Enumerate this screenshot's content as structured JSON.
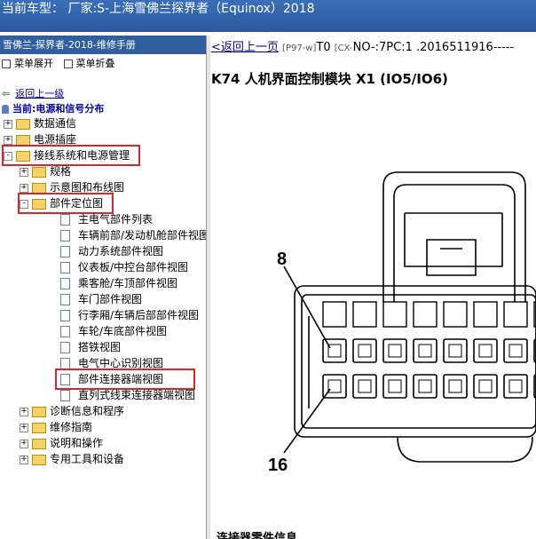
{
  "window": {
    "title": "当前车型： 厂家:S-上海雪佛兰探界者（Equinox）2018"
  },
  "left_panel": {
    "header": "雪佛兰-探界者-2018-维修手册",
    "toolbar": {
      "expand": "菜单展开",
      "collapse": "菜单折叠"
    },
    "back_link": "返回上一级",
    "current": "当前:电源和信号分布",
    "tree": [
      {
        "label": "数据通信",
        "level": 0,
        "type": "folder",
        "expander": "+"
      },
      {
        "label": "电源插座",
        "level": 0,
        "type": "folder",
        "expander": "+"
      },
      {
        "label": "接线系统和电源管理",
        "level": 0,
        "type": "folder",
        "expander": "-",
        "highlight": true
      },
      {
        "label": "规格",
        "level": 1,
        "type": "folder",
        "expander": "+"
      },
      {
        "label": "示意图和布线图",
        "level": 1,
        "type": "folder",
        "expander": "+"
      },
      {
        "label": "部件定位图",
        "level": 1,
        "type": "folder",
        "expander": "-",
        "highlight": true
      },
      {
        "label": "主电气部件列表",
        "level": 2,
        "type": "doc"
      },
      {
        "label": "车辆前部/发动机舱部件视图",
        "level": 2,
        "type": "doc"
      },
      {
        "label": "动力系统部件视图",
        "level": 2,
        "type": "doc"
      },
      {
        "label": "仪表板/中控台部件视图",
        "level": 2,
        "type": "doc"
      },
      {
        "label": "乘客舱/车顶部件视图",
        "level": 2,
        "type": "doc"
      },
      {
        "label": "车门部件视图",
        "level": 2,
        "type": "doc"
      },
      {
        "label": "行李厢/车辆后部部件视图",
        "level": 2,
        "type": "doc"
      },
      {
        "label": "车轮/车底部件视图",
        "level": 2,
        "type": "doc"
      },
      {
        "label": "搭铁视图",
        "level": 2,
        "type": "doc"
      },
      {
        "label": "电气中心识别视图",
        "level": 2,
        "type": "doc"
      },
      {
        "label": "部件连接器端视图",
        "level": 2,
        "type": "doc",
        "highlight": true
      },
      {
        "label": "直列式线束连接器端视图",
        "level": 2,
        "type": "doc"
      },
      {
        "label": "诊断信息和程序",
        "level": 1,
        "type": "folder",
        "expander": "+"
      },
      {
        "label": "维修指南",
        "level": 1,
        "type": "folder",
        "expander": "+"
      },
      {
        "label": "说明和操作",
        "level": 1,
        "type": "folder",
        "expander": "+"
      },
      {
        "label": "专用工具和设备",
        "level": 1,
        "type": "folder",
        "expander": "+"
      }
    ]
  },
  "content": {
    "nav_link": "<返回上一页",
    "nav_code": "[P97-w]",
    "nav_id": "T0",
    "nav_cx": "[CX-",
    "nav_rest": "NO-:7PC:1 .2016511916-----",
    "heading": "K74 人机界面控制模块 X1 (IO5/IO6)",
    "pin_label_top": "8",
    "pin_label_bottom": "16",
    "section_title": "连接器零件信息"
  },
  "colors": {
    "highlight": "#d6282c",
    "link": "#0000aa",
    "titlebar": "#2c5aa0"
  }
}
